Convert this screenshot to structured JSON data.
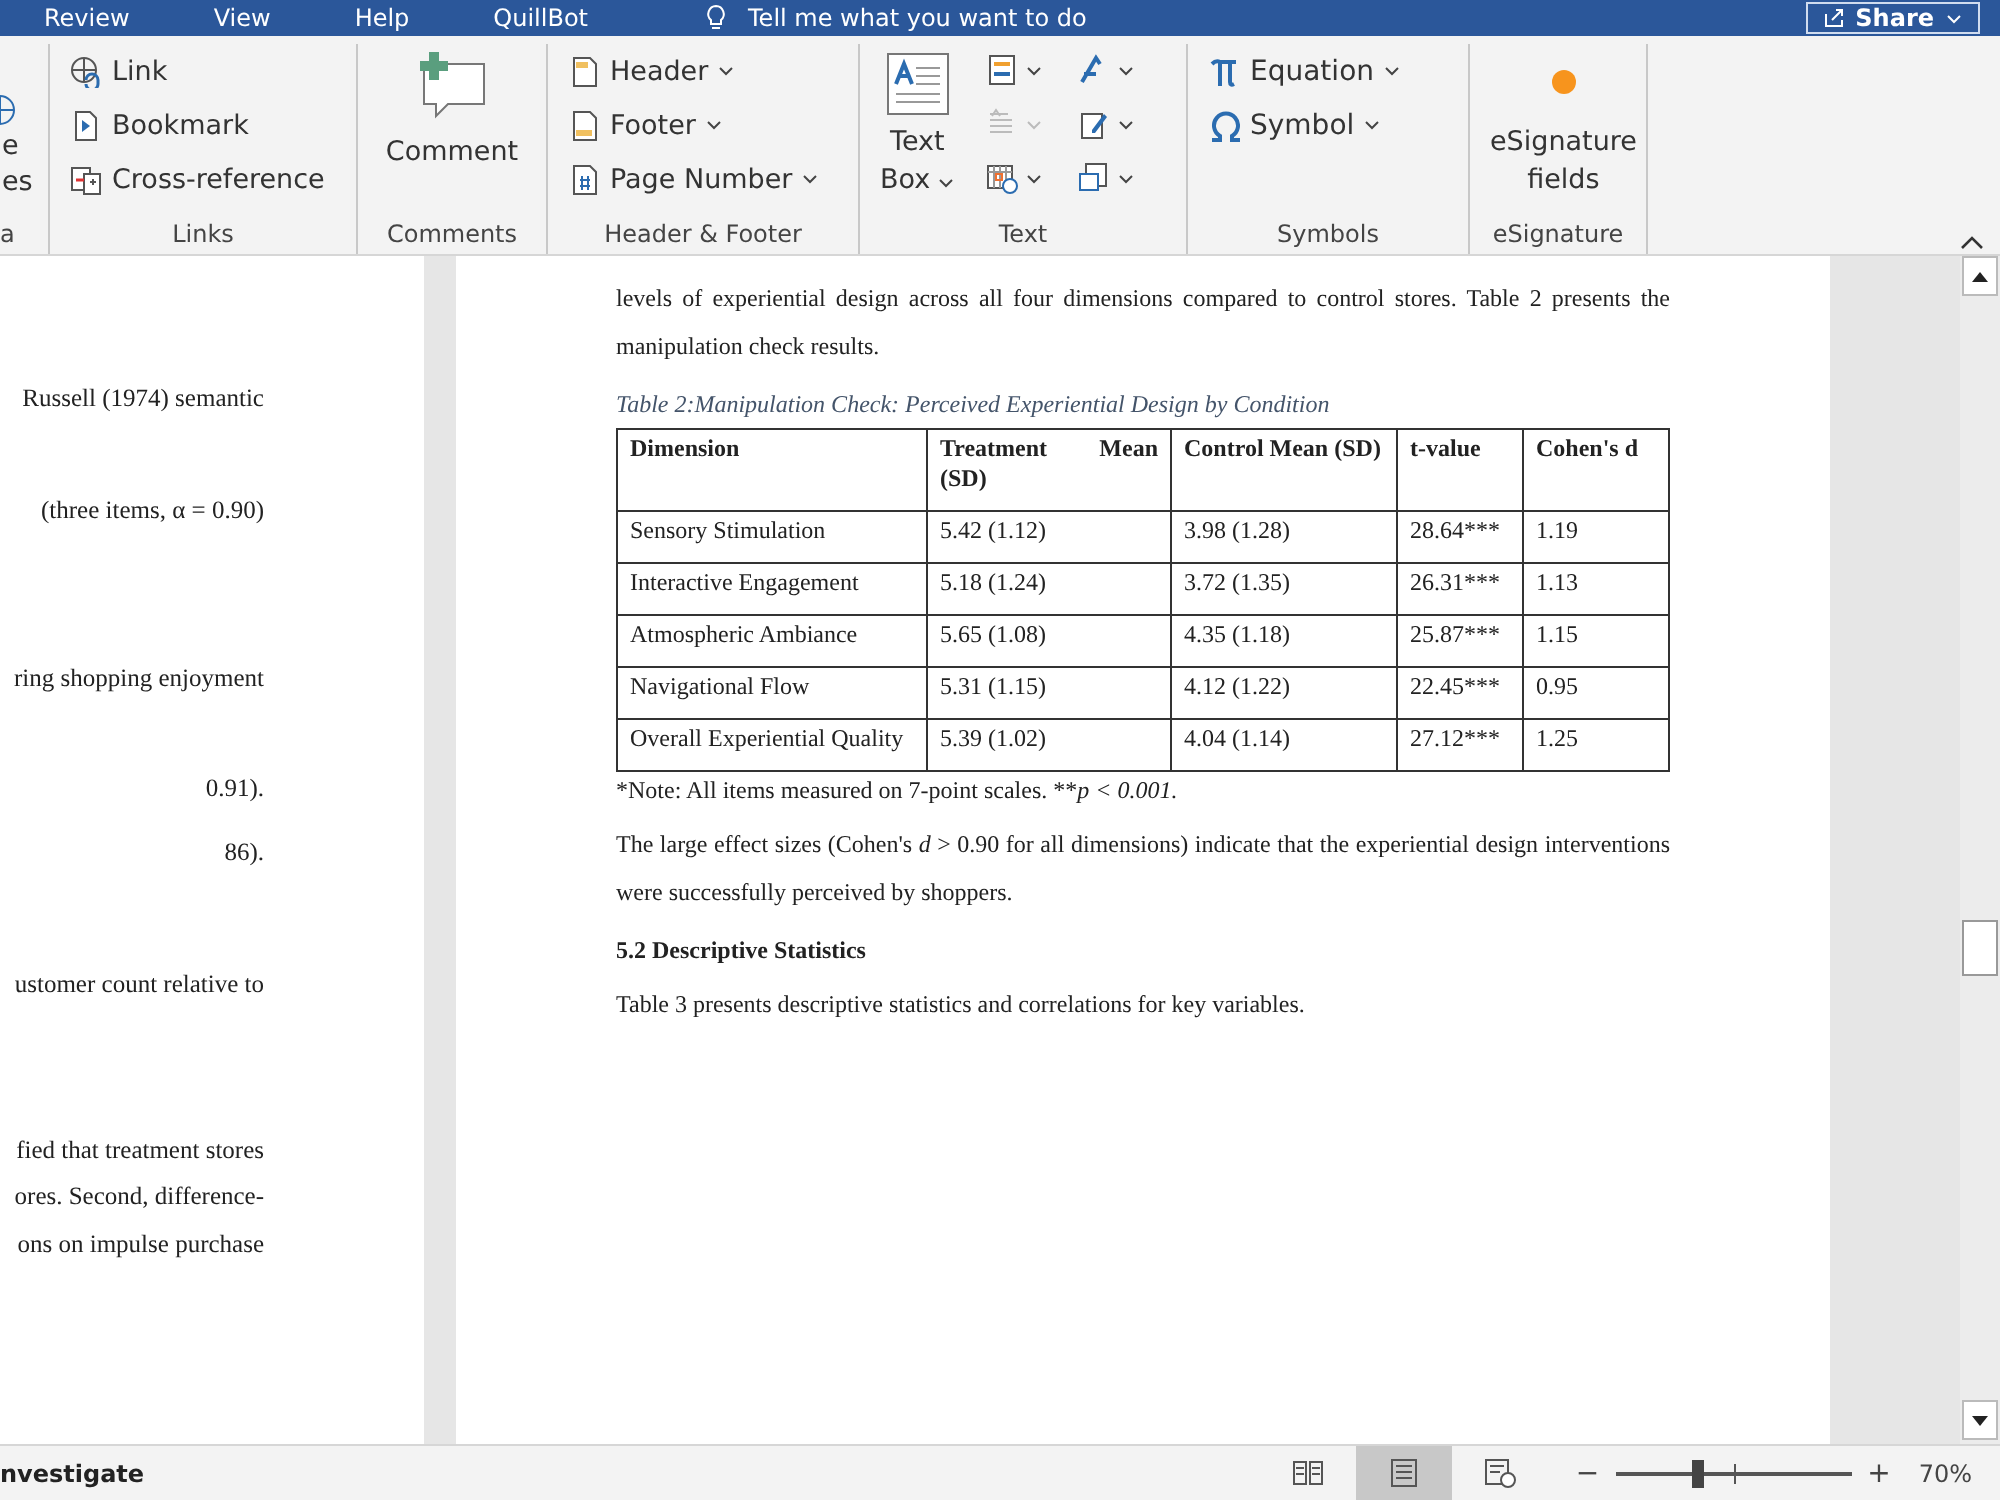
{
  "menu_tabs": [
    "Review",
    "View",
    "Help",
    "QuillBot"
  ],
  "tell_me": "Tell me what you want to do",
  "share_button": "Share",
  "ribbon_groups": [
    {
      "kind": "partial",
      "items": [
        "e",
        "es"
      ],
      "label": "a"
    },
    {
      "kind": "list",
      "items": [
        {
          "label": "Link",
          "dropdown": false
        },
        {
          "label": "Bookmark",
          "dropdown": false
        },
        {
          "label": "Cross-reference",
          "dropdown": false
        }
      ],
      "label": "Links"
    },
    {
      "kind": "big",
      "items": [
        "Comment"
      ],
      "label": "Comments"
    },
    {
      "kind": "list",
      "items": [
        {
          "label": "Header",
          "dropdown": true
        },
        {
          "label": "Footer",
          "dropdown": true
        },
        {
          "label": "Page Number",
          "dropdown": true
        }
      ],
      "label": "Header & Footer"
    },
    {
      "kind": "text",
      "items": [
        "Text",
        "Box"
      ],
      "label": "Text"
    },
    {
      "kind": "list",
      "items": [
        {
          "label": "Equation",
          "dropdown": true
        },
        {
          "label": "Symbol",
          "dropdown": true
        }
      ],
      "label": "Symbols"
    },
    {
      "kind": "big",
      "items": [
        "eSignature",
        "fields"
      ],
      "label": "eSignature"
    }
  ],
  "left_page_lines": [
    "Russell (1974) semantic",
    "(three items, α = 0.90)",
    "ring shopping enjoyment",
    "0.91).",
    "86).",
    "ustomer count relative to",
    "fied that treatment stores",
    "ores. Second, difference-",
    "ons on impulse purchase"
  ],
  "paragraph_1": "levels of experiential design across all four dimensions compared to control stores. Table 2 presents the manipulation check results.",
  "table_caption": "Table 2:Manipulation Check: Perceived Experiential Design by Condition",
  "table": {
    "columns": [
      "Dimension",
      "Treatment Mean (SD)",
      "Control Mean (SD)",
      "t-value",
      "Cohen's d"
    ],
    "rows": [
      [
        "Sensory Stimulation",
        "5.42 (1.12)",
        "3.98 (1.28)",
        "28.64***",
        "1.19"
      ],
      [
        "Interactive Engagement",
        "5.18 (1.24)",
        "3.72 (1.35)",
        "26.31***",
        "1.13"
      ],
      [
        "Atmospheric Ambiance",
        "5.65 (1.08)",
        "4.35 (1.18)",
        "25.87***",
        "1.15"
      ],
      [
        "Navigational Flow",
        "5.31 (1.15)",
        "4.12 (1.22)",
        "22.45***",
        "0.95"
      ],
      [
        "Overall Experiential Quality",
        "5.39 (1.02)",
        "4.04 (1.14)",
        "27.12***",
        "1.25"
      ]
    ]
  },
  "table_note": {
    "text": "*Note: All items measured on 7-point scales. **",
    "italic_part": "p < 0.001."
  },
  "paragraph_2": "The large effect sizes (Cohen's *d* > 0.90 for all dimensions) indicate that the experiential design interventions were successfully perceived by shoppers.",
  "heading": "5.2 Descriptive Statistics",
  "paragraph_3": "Table 3 presents descriptive statistics and correlations for key variables.",
  "status_bar": {
    "left_text": "nvestigate",
    "views": [
      {
        "kind": "read",
        "selected": false
      },
      {
        "kind": "print",
        "selected": true
      },
      {
        "kind": "web",
        "selected": false
      }
    ],
    "zoom": {
      "level": 0.35,
      "reading": "70%",
      "minus": "−",
      "plus": "+"
    }
  }
}
